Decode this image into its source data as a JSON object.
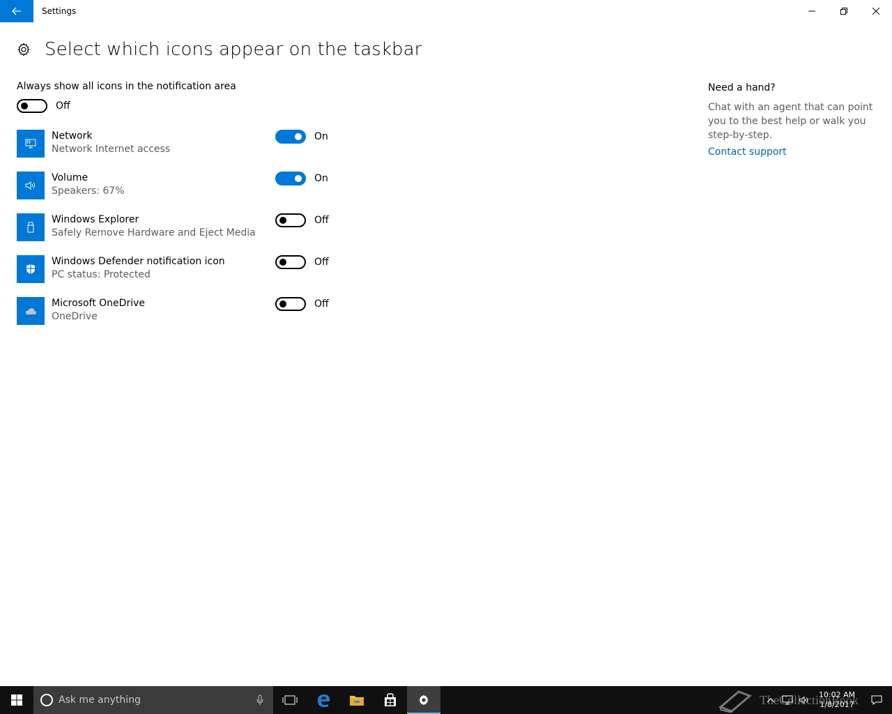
{
  "window": {
    "title": "Settings"
  },
  "header": {
    "title": "Select which icons appear on the taskbar"
  },
  "always_show": {
    "label": "Always show all icons in the notification area",
    "state": "Off"
  },
  "items": [
    {
      "title": "Network",
      "subtitle": "Network Internet access",
      "state": "On",
      "icon": "network-icon"
    },
    {
      "title": "Volume",
      "subtitle": "Speakers: 67%",
      "state": "On",
      "icon": "volume-icon"
    },
    {
      "title": "Windows Explorer",
      "subtitle": "Safely Remove Hardware and Eject Media",
      "state": "Off",
      "icon": "usb-icon"
    },
    {
      "title": "Windows Defender notification icon",
      "subtitle": "PC status: Protected",
      "state": "Off",
      "icon": "shield-icon"
    },
    {
      "title": "Microsoft OneDrive",
      "subtitle": "OneDrive",
      "state": "Off",
      "icon": "cloud-icon"
    }
  ],
  "help": {
    "title": "Need a hand?",
    "body": "Chat with an agent that can point you to the best help or walk you step-by-step.",
    "link": "Contact support"
  },
  "taskbar": {
    "search_placeholder": "Ask me anything",
    "time": "10:02 AM",
    "date": "1/8/2017",
    "watermark": "TheCollectionBook"
  },
  "colors": {
    "accent": "#0078d7",
    "link": "#0063b1",
    "taskbar": "#101010"
  }
}
